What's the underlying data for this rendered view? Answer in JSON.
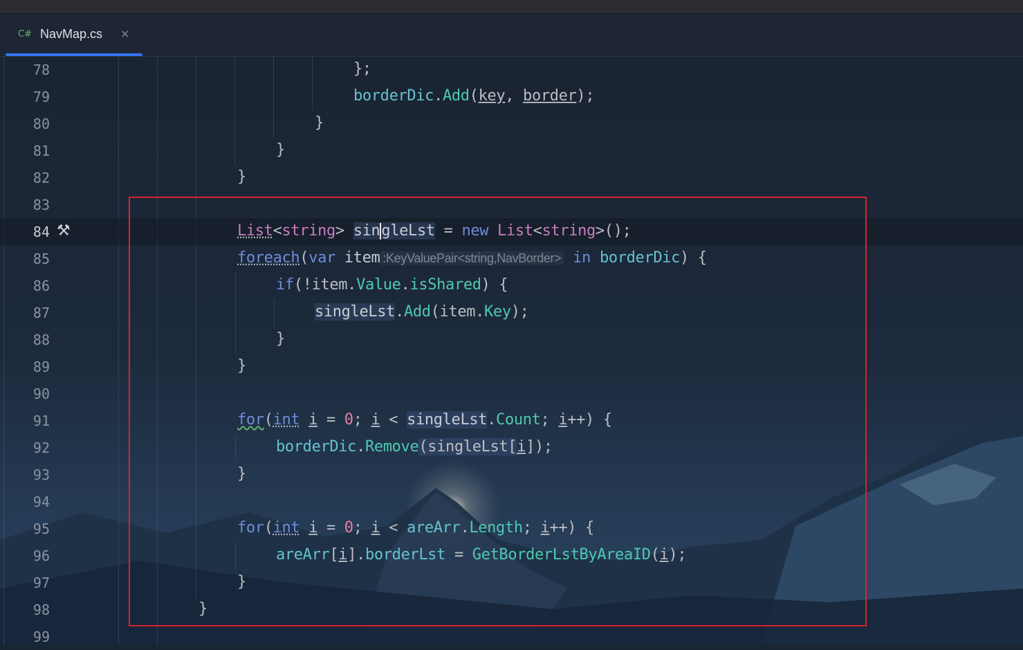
{
  "tab": {
    "icon_text": "C#",
    "label": "NavMap.cs",
    "close_glyph": "×"
  },
  "colors": {
    "accent": "#3574f0",
    "annotation_box": "#d9232d"
  },
  "lines": [
    {
      "n": "78"
    },
    {
      "n": "79"
    },
    {
      "n": "80"
    },
    {
      "n": "81"
    },
    {
      "n": "82"
    },
    {
      "n": "83"
    },
    {
      "n": "84"
    },
    {
      "n": "85"
    },
    {
      "n": "86"
    },
    {
      "n": "87"
    },
    {
      "n": "88"
    },
    {
      "n": "89"
    },
    {
      "n": "90"
    },
    {
      "n": "91"
    },
    {
      "n": "92"
    },
    {
      "n": "93"
    },
    {
      "n": "94"
    },
    {
      "n": "95"
    },
    {
      "n": "96"
    },
    {
      "n": "97"
    },
    {
      "n": "98"
    },
    {
      "n": "99"
    }
  ],
  "code": {
    "l78": "};",
    "l79": {
      "a": "borderDic",
      "b": ".",
      "c": "Add",
      "d": "(",
      "e": "key",
      ",": ", ",
      "f": "border",
      "g": ");"
    },
    "l80": "}",
    "l81": "}",
    "l82": "}",
    "l84": {
      "t1": "List",
      "t2": "<",
      "t3": "string",
      "t4": ">",
      "sp": " ",
      "v1": "sin",
      "v2": "gleLst",
      "eq": " = ",
      "kw": "new",
      "sp2": " ",
      "t5": "List",
      "t6": "<",
      "t7": "string",
      "t8": ">();"
    },
    "l85": {
      "kw": "foreach",
      "p1": "(",
      "kw2": "var",
      "sp": " ",
      "id": "item",
      "hint": ":KeyValuePair<string,NavBorder>",
      "sp2": " ",
      "kw3": "in",
      "sp3": " ",
      "fl": "borderDic",
      "end": ") {"
    },
    "l86": {
      "kw": "if",
      "p1": "(!item.",
      "me1": "Value",
      "dot": ".",
      "me2": "isShared",
      "end": ") {"
    },
    "l87": {
      "id": "singleLst",
      "dot": ".",
      "fn": "Add",
      "p1": "(item.",
      "me": "Key",
      "end": ");"
    },
    "l88": "}",
    "l89": "}",
    "l91": {
      "kw": "for",
      "p1": "(",
      "ty": "int",
      "sp": " ",
      "i1": "i",
      "eq": " = ",
      "n": "0",
      "sc": "; ",
      "i2": "i",
      "lt": " < ",
      "id": "singleLst",
      "dot": ".",
      "me": "Count",
      "sc2": "; ",
      "i3": "i",
      "end": "++) {"
    },
    "l92": {
      "fl": "borderDic",
      "dot": ".",
      "fn": "Remove",
      "p1": "(singleLst[",
      "i": "i",
      "end": "]);"
    },
    "l93": "}",
    "l95": {
      "kw": "for",
      "p1": "(",
      "ty": "int",
      "sp": " ",
      "i1": "i",
      "eq": " = ",
      "n": "0",
      "sc": "; ",
      "i2": "i",
      "lt": " < ",
      "id": "areArr",
      "dot": ".",
      "me": "Length",
      "sc2": "; ",
      "i3": "i",
      "end": "++) {"
    },
    "l96": {
      "id": "areArr",
      "p1": "[",
      "i": "i",
      "p2": "].",
      "me": "borderLst",
      "eq": " = ",
      "fn": "GetBorderLstByAreaID",
      "p3": "(",
      "i2": "i",
      "end": ");"
    },
    "l97": "}",
    "l98": "}"
  }
}
